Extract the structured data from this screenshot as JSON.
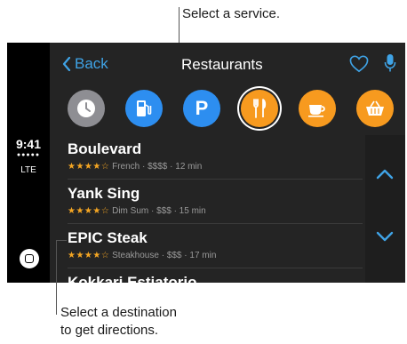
{
  "callouts": {
    "top": "Select a service.",
    "bottom": "Select a destination\nto get directions."
  },
  "status": {
    "time": "9:41",
    "signal": "●●●●●",
    "network": "LTE"
  },
  "nav": {
    "back_label": "Back",
    "title": "Restaurants"
  },
  "icons": {
    "back": "chevron-left-icon",
    "favorite": "heart-icon",
    "voice": "mic-icon",
    "home": "home-square-icon",
    "scroll_up": "chevron-up-icon",
    "scroll_down": "chevron-down-icon"
  },
  "colors": {
    "accent": "#3fa3e6",
    "app_bg": "#242424",
    "services": [
      "#8e8e93",
      "#2d8ef0",
      "#2d8ef0",
      "#f79a1f",
      "#f79a1f",
      "#f79a1f"
    ]
  },
  "services": [
    {
      "name": "recent",
      "icon": "clock-icon"
    },
    {
      "name": "gas-stations",
      "icon": "fuel-pump-icon"
    },
    {
      "name": "parking",
      "icon": "parking-icon",
      "glyph": "P"
    },
    {
      "name": "restaurants",
      "icon": "fork-knife-icon",
      "selected": true
    },
    {
      "name": "coffee",
      "icon": "coffee-cup-icon"
    },
    {
      "name": "groceries",
      "icon": "basket-icon"
    }
  ],
  "destinations": [
    {
      "name": "Boulevard",
      "stars": "★★★★☆",
      "details": "French · $$$$ · 12 min"
    },
    {
      "name": "Yank Sing",
      "stars": "★★★★☆",
      "details": "Dim Sum · $$$ · 15 min"
    },
    {
      "name": "EPIC Steak",
      "stars": "★★★★☆",
      "details": "Steakhouse · $$$ · 17 min"
    },
    {
      "name": "Kokkari Estiatorio",
      "stars": "",
      "details": ""
    }
  ]
}
